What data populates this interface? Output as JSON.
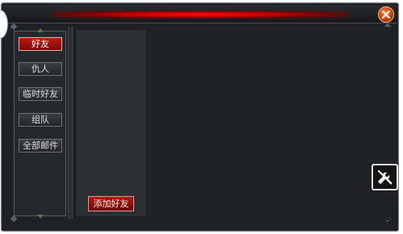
{
  "window": {
    "accent_color": "#d41a12"
  },
  "tabs": [
    {
      "label": "好友",
      "active": true
    },
    {
      "label": "仇人",
      "active": false
    },
    {
      "label": "临时好友",
      "active": false
    },
    {
      "label": "组队",
      "active": false
    },
    {
      "label": "全部邮件",
      "active": false
    }
  ],
  "actions": {
    "add_friend_label": "添加好友",
    "close_icon": "close-icon",
    "settings_icon": "wrench-icon"
  }
}
